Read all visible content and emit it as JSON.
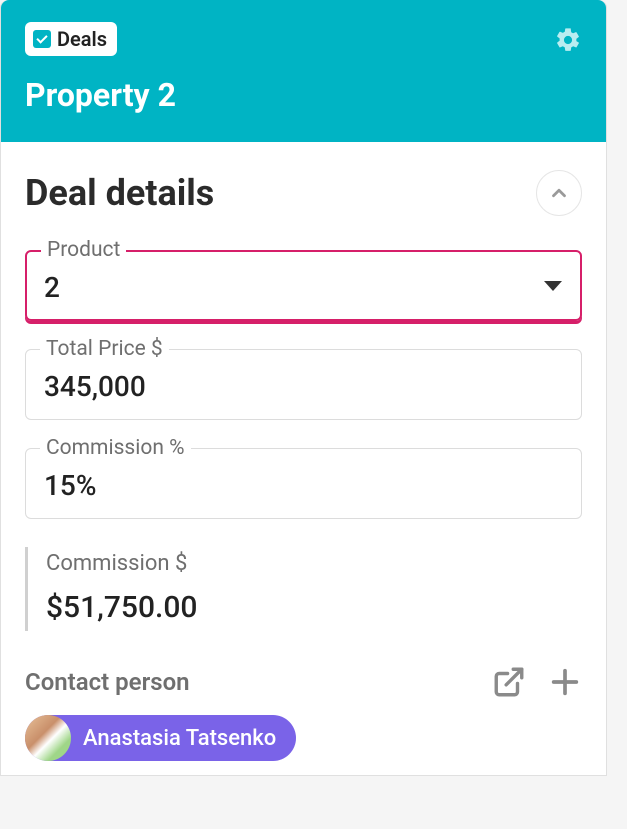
{
  "header": {
    "chip_label": "Deals",
    "title": "Property 2"
  },
  "section": {
    "title": "Deal details"
  },
  "fields": {
    "product": {
      "label": "Product",
      "value": "2"
    },
    "total_price": {
      "label": "Total Price $",
      "value": "345,000"
    },
    "commission_pct": {
      "label": "Commission %",
      "value": "15%"
    },
    "commission_amt": {
      "label": "Commission $",
      "value": "$51,750.00"
    }
  },
  "contact": {
    "section_label": "Contact person",
    "name": "Anastasia Tatsenko"
  }
}
